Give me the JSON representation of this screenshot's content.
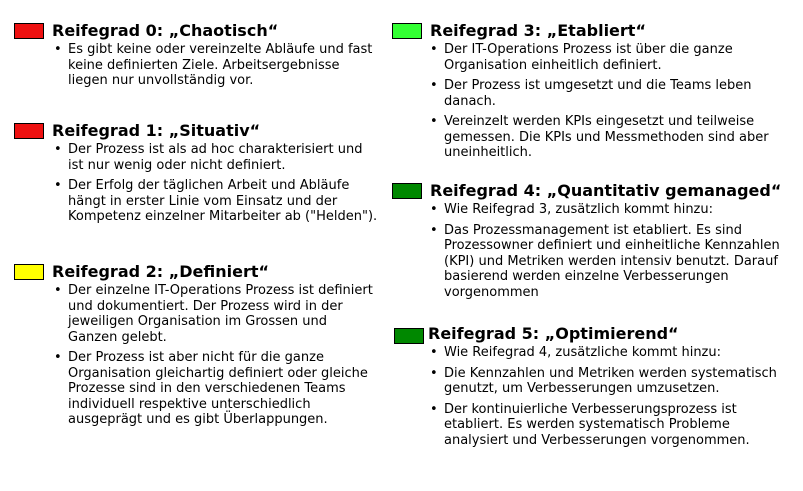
{
  "colors": {
    "red": "#ee1111",
    "yellow": "#ffff00",
    "light_green": "#33ff33",
    "dark_green": "#008800"
  },
  "levels": [
    {
      "title": "Reifegrad 0: „Chaotisch“",
      "color": "#ee1111",
      "bullets": [
        "Es gibt keine oder vereinzelte Abläufe und fast keine definierten Ziele. Arbeitsergebnisse liegen nur unvollständig vor."
      ]
    },
    {
      "title": "Reifegrad 1: „Situativ“",
      "color": "#ee1111",
      "bullets": [
        "Der Prozess ist als ad hoc charakterisiert und ist nur wenig oder nicht definiert.",
        "Der Erfolg der täglichen Arbeit und Abläufe hängt in erster Linie vom Einsatz und der Kompetenz einzelner Mitarbeiter ab (\"Helden\")."
      ]
    },
    {
      "title": "Reifegrad 2: „Definiert“",
      "color": "#ffff00",
      "bullets": [
        "Der einzelne IT-Operations Prozess ist definiert und dokumentiert. Der Prozess wird in der jeweiligen Organisation im Grossen und Ganzen gelebt.",
        "Der Prozess ist aber nicht für die ganze Organisation gleichartig definiert oder gleiche Prozesse sind in den verschiedenen Teams individuell respektive unterschiedlich ausgeprägt und es gibt Überlappungen."
      ]
    },
    {
      "title": "Reifegrad 3: „Etabliert“",
      "color": "#33ff33",
      "bullets": [
        "Der IT-Operations Prozess ist über die ganze Organisation einheitlich definiert.",
        "Der Prozess ist umgesetzt und die Teams leben danach.",
        "Vereinzelt werden KPIs eingesetzt und teilweise gemessen. Die KPIs und Messmethoden sind aber uneinheitlich."
      ]
    },
    {
      "title": "Reifegrad 4: „Quantitativ gemanaged“",
      "color": "#008800",
      "bullets": [
        "Wie Reifegrad 3, zusätzlich kommt hinzu:",
        "Das Prozessmanagement ist etabliert. Es sind Prozessowner definiert und einheitliche Kennzahlen (KPI) und Metriken werden intensiv benutzt. Darauf basierend werden einzelne Verbesserungen vorgenommen"
      ]
    },
    {
      "title": "Reifegrad 5: „Optimierend“",
      "color": "#008800",
      "bullets": [
        "Wie Reifegrad 4, zusätzliche kommt hinzu:",
        "Die Kennzahlen und Metriken werden systematisch genutzt, um Verbesserungen umzusetzen.",
        "Der kontinuierliche Verbesserungsprozess ist etabliert. Es werden systematisch Probleme analysiert und Verbesserungen vorgenommen."
      ]
    }
  ]
}
